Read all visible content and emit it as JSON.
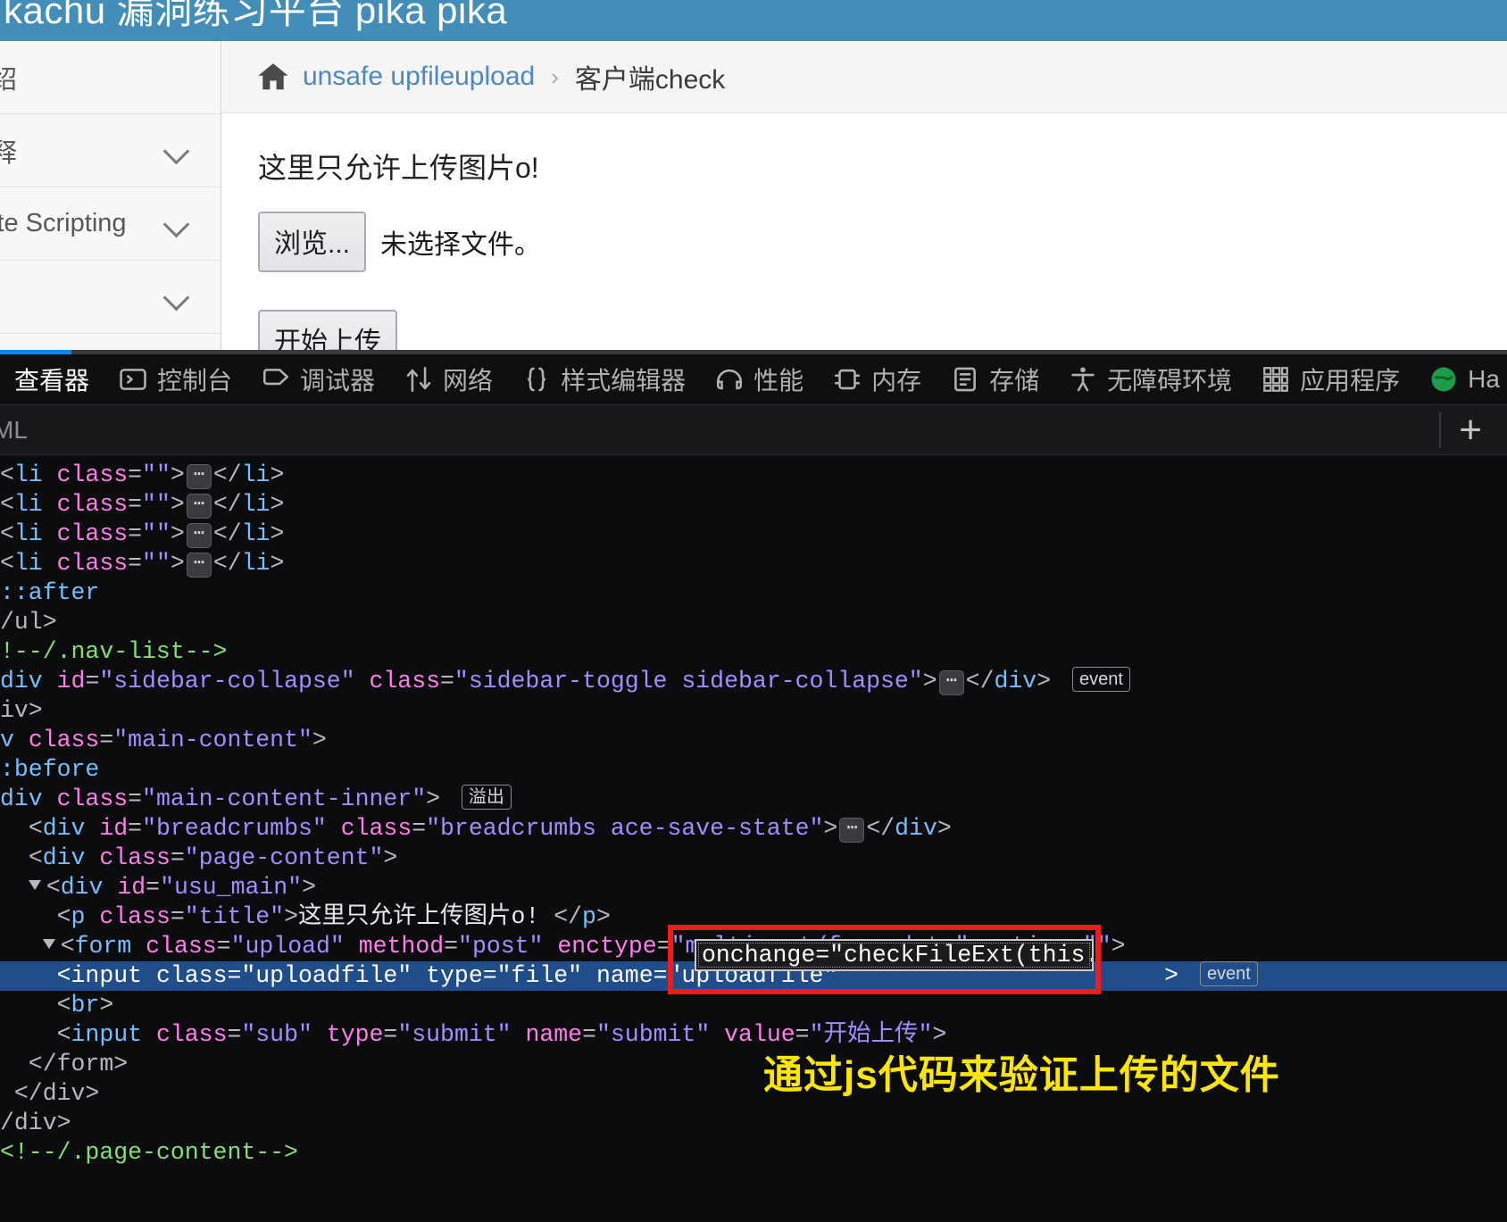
{
  "app": {
    "header_title": "kachu 漏洞练习平台 pika  pika"
  },
  "sidebar": {
    "items": [
      {
        "label": "绍",
        "has_chevron": false
      },
      {
        "label": "释",
        "has_chevron": true
      },
      {
        "label": "ite Scripting",
        "has_chevron": true
      },
      {
        "label": "",
        "has_chevron": true
      }
    ]
  },
  "breadcrumb": {
    "home_icon": "home-icon",
    "link": "unsafe upfileupload",
    "separator": "›",
    "current": "客户端check"
  },
  "main": {
    "title": "这里只允许上传图片o!",
    "browse_button": "浏览...",
    "no_file_text": "未选择文件。",
    "submit_button": "开始上传"
  },
  "devtools": {
    "tabs": [
      {
        "label": "查看器",
        "icon": "inspector-icon",
        "active": true
      },
      {
        "label": "控制台",
        "icon": "console-icon",
        "active": false
      },
      {
        "label": "调试器",
        "icon": "debugger-icon",
        "active": false
      },
      {
        "label": "网络",
        "icon": "network-icon",
        "active": false
      },
      {
        "label": "样式编辑器",
        "icon": "style-editor-icon",
        "active": false
      },
      {
        "label": "性能",
        "icon": "performance-icon",
        "active": false
      },
      {
        "label": "内存",
        "icon": "memory-icon",
        "active": false
      },
      {
        "label": "存储",
        "icon": "storage-icon",
        "active": false
      },
      {
        "label": "无障碍环境",
        "icon": "accessibility-icon",
        "active": false
      },
      {
        "label": "应用程序",
        "icon": "application-icon",
        "active": false
      },
      {
        "label": "Ha",
        "icon": "hackbar-icon",
        "active": false
      }
    ],
    "panel_label": "ML",
    "add_button": "+",
    "markup": {
      "rows": [
        {
          "indent": 0,
          "kind": "li"
        },
        {
          "indent": 0,
          "kind": "li"
        },
        {
          "indent": 0,
          "kind": "li"
        },
        {
          "indent": 0,
          "kind": "li"
        },
        {
          "indent": 0,
          "kind": "pseudo",
          "text": "::after"
        },
        {
          "indent": 0,
          "kind": "close",
          "text": "/ul>"
        },
        {
          "indent": 0,
          "kind": "comment",
          "text": "!--/.nav-list-->"
        },
        {
          "indent": 0,
          "kind": "sidebar_collapse"
        },
        {
          "indent": 0,
          "kind": "close",
          "text": "iv>"
        },
        {
          "indent": 0,
          "kind": "main_content"
        },
        {
          "indent": 0,
          "kind": "pseudo",
          "text": ":before"
        },
        {
          "indent": 0,
          "kind": "main_content_inner"
        },
        {
          "indent": 0,
          "kind": "breadcrumbs_row"
        },
        {
          "indent": 0,
          "kind": "page_content_row"
        },
        {
          "indent": 0,
          "kind": "usu_main_row"
        },
        {
          "indent": 0,
          "kind": "title_p_row"
        },
        {
          "indent": 0,
          "kind": "form_row"
        },
        {
          "indent": 0,
          "kind": "input_file_row",
          "selected": true
        },
        {
          "indent": 0,
          "kind": "br_row"
        },
        {
          "indent": 0,
          "kind": "input_sub_row"
        },
        {
          "indent": 0,
          "kind": "close",
          "text": "  </form>"
        },
        {
          "indent": 0,
          "kind": "close",
          "text": " </div>"
        },
        {
          "indent": 0,
          "kind": "close",
          "text": "/div>"
        },
        {
          "indent": 0,
          "kind": "comment",
          "text": "<!--/.page-content-->"
        }
      ],
      "li_tag": "li",
      "li_class_attr": "class",
      "li_class_value": "\"\"",
      "overflow_badge": "溢出",
      "event_badge": "event",
      "sidebar_collapse_id_value": "\"sidebar-collapse\"",
      "sidebar_collapse_class_value": "\"sidebar-toggle sidebar-collapse\"",
      "main_content_class_value": "\"main-content\"",
      "main_content_inner_class_value": "\"main-content-inner\"",
      "breadcrumbs_id_value": "\"breadcrumbs\"",
      "breadcrumbs_class_value": "\"breadcrumbs ace-save-state\"",
      "page_content_class_value": "\"page-content\"",
      "usu_main_id_value": "\"usu_main\"",
      "title_p_class_value": "\"title\"",
      "title_p_text": "这里只允许上传图片o!",
      "form_class_value": "\"upload\"",
      "form_method_value": "\"post\"",
      "form_enctype_value": "\"multipart/form-data\"",
      "form_action_value": "\"\"",
      "input_file_class_value": "\"uploadfile\"",
      "input_file_type_value": "\"file\"",
      "input_file_name_value": "\"uploadfile\"",
      "input_sub_class_value": "\"sub\"",
      "input_sub_type_value": "\"submit\"",
      "input_sub_name_value": "\"submit\"",
      "input_sub_value_value": "\"开始上传\""
    },
    "attribute_editor": {
      "value": "onchange=\"checkFileExt(this.value)\""
    }
  },
  "annotation": {
    "note_text": "通过js代码来验证上传的文件",
    "note_color": "#ffe600",
    "highlight_box_color": "#f21b1b"
  },
  "colors": {
    "header_blue": "#438eb9",
    "link_blue": "#4b88c4",
    "devtools_bg": "#0b0c0e",
    "selected_row": "#204e8a",
    "accent": "#0a84ff"
  }
}
